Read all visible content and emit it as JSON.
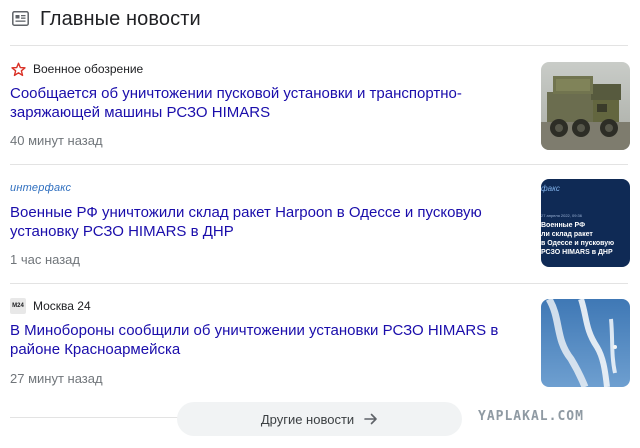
{
  "header": {
    "title": "Главные новости",
    "icon": "newspaper-icon"
  },
  "articles": [
    {
      "source": "Военное обозрение",
      "source_icon": "red-star-icon",
      "headline": "Сообщается об уничтожении пусковой установки и транспортно-заряжающей машины РСЗО HIMARS",
      "time": "40 минут назад",
      "thumbnail": "military-vehicle-photo"
    },
    {
      "source_logo_text": "интерфакс",
      "headline": "Военные РФ уничтожили склад ракет Harpoon в Одессе и пусковую установку РСЗО HIMARS в ДНР",
      "time": "1 час назад",
      "thumbnail": "interfax-news-card",
      "thumbnail_lines": [
        "Военные РФ",
        "ли склад ракет",
        "в Одессе и пусковую",
        "РСЗО HIMARS в ДНР"
      ],
      "thumbnail_logo": "факс",
      "thumbnail_date": "27 апреля 2022, 09:36"
    },
    {
      "source": "Москва 24",
      "source_logo_text": "М24",
      "headline": "В Минобороны сообщили об уничтожении установки РСЗО HIMARS в районе Красноармейска",
      "time": "27 минут назад",
      "thumbnail": "missile-launch-sky-photo"
    }
  ],
  "more_button": {
    "label": "Другие новости",
    "icon": "arrow-right-icon"
  },
  "watermark": "YAPLAKAL.COM",
  "colors": {
    "headline_link": "#1a0dab",
    "meta": "#70757a",
    "interfax_blue": "#2f6fbf",
    "vo_red": "#d93025"
  }
}
